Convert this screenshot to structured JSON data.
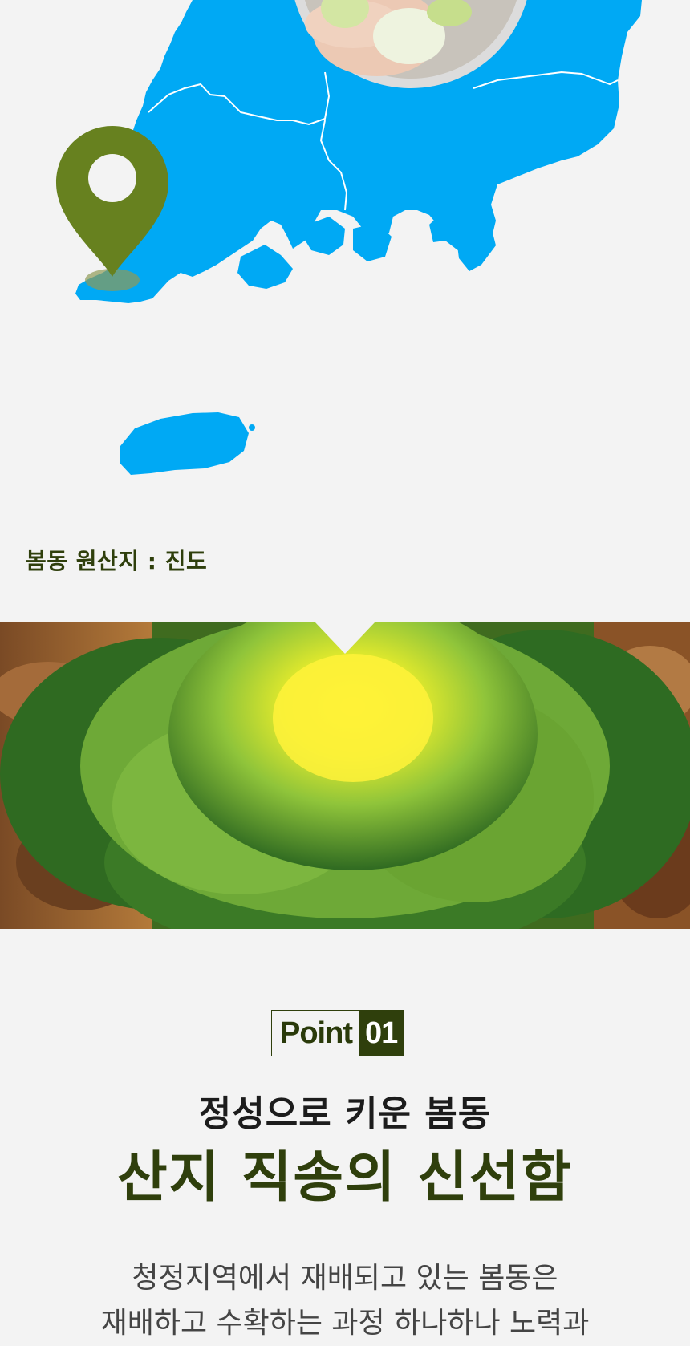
{
  "map": {
    "origin_caption": "봄동 원산지 : 진도",
    "land_color": "#00a9f4",
    "pin_color": "#67811f"
  },
  "banner": {
    "image": "cabbage-closeup-photo"
  },
  "point": {
    "label": "Point",
    "number": "01",
    "subtitle": "정성으로 키운 봄동",
    "title": "산지 직송의 신선함",
    "body_lines": [
      "청정지역에서 재배되고 있는 봄동은",
      "재배하고 수확하는 과정 하나하나 노력과"
    ]
  }
}
